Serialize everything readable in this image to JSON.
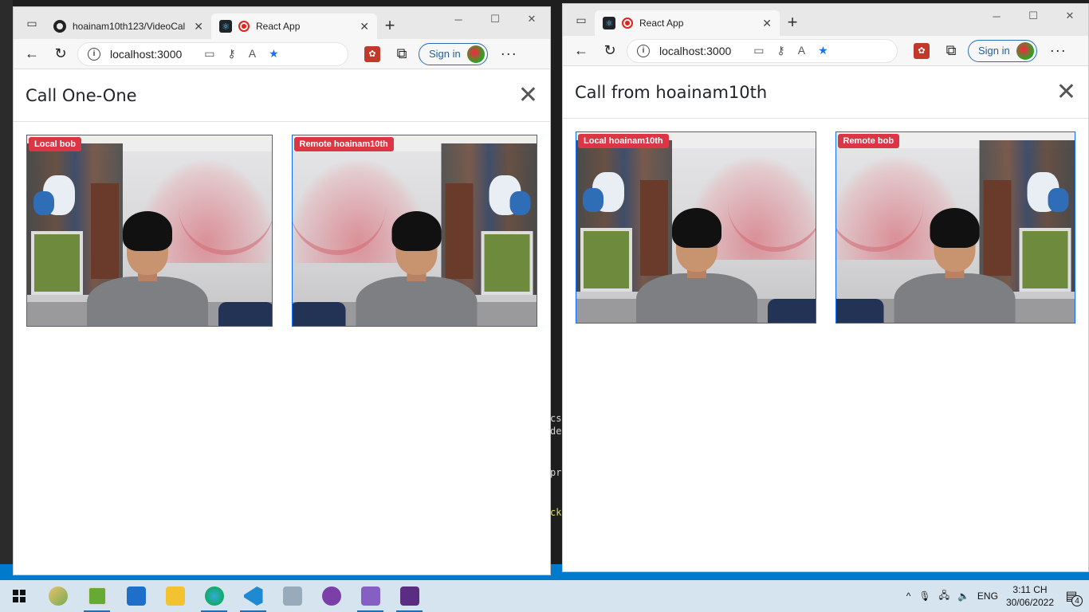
{
  "left_window": {
    "tabs": [
      {
        "title": "hoainam10th123/VideoCal",
        "favicon": "github-icon",
        "active": false
      },
      {
        "title": "React App",
        "favicon": "react-icon",
        "active": true
      }
    ],
    "address": "localhost:3000",
    "sign_in_label": "Sign in",
    "modal_title": "Call One-One",
    "videos": [
      {
        "label": "Local bob"
      },
      {
        "label": "Remote hoainam10th"
      }
    ]
  },
  "right_window": {
    "tabs": [
      {
        "title": "React App",
        "favicon": "react-icon",
        "active": true
      }
    ],
    "address": "localhost:3000",
    "sign_in_label": "Sign in",
    "modal_title": "Call from hoainam10th",
    "videos": [
      {
        "label": "Local hoainam10th"
      },
      {
        "label": "Remote bob"
      }
    ]
  },
  "background_code": [
    "cs:",
    "der",
    "pr",
    "ck"
  ],
  "taskbar": {
    "apps": [
      "paint-icon",
      "notepad-icon",
      "mail-icon",
      "file-explorer-icon",
      "edge-icon",
      "vscode-icon",
      "app-icon",
      "github-desktop-icon",
      "visual-studio-icon",
      "terminal-icon"
    ],
    "language": "ENG",
    "time": "3:11 CH",
    "date": "30/06/2022",
    "notification_count": "4"
  },
  "colors": {
    "label_bg": "#dc3545",
    "video_border": "#0d6efd",
    "taskbar_bg": "#d6e4ef"
  }
}
